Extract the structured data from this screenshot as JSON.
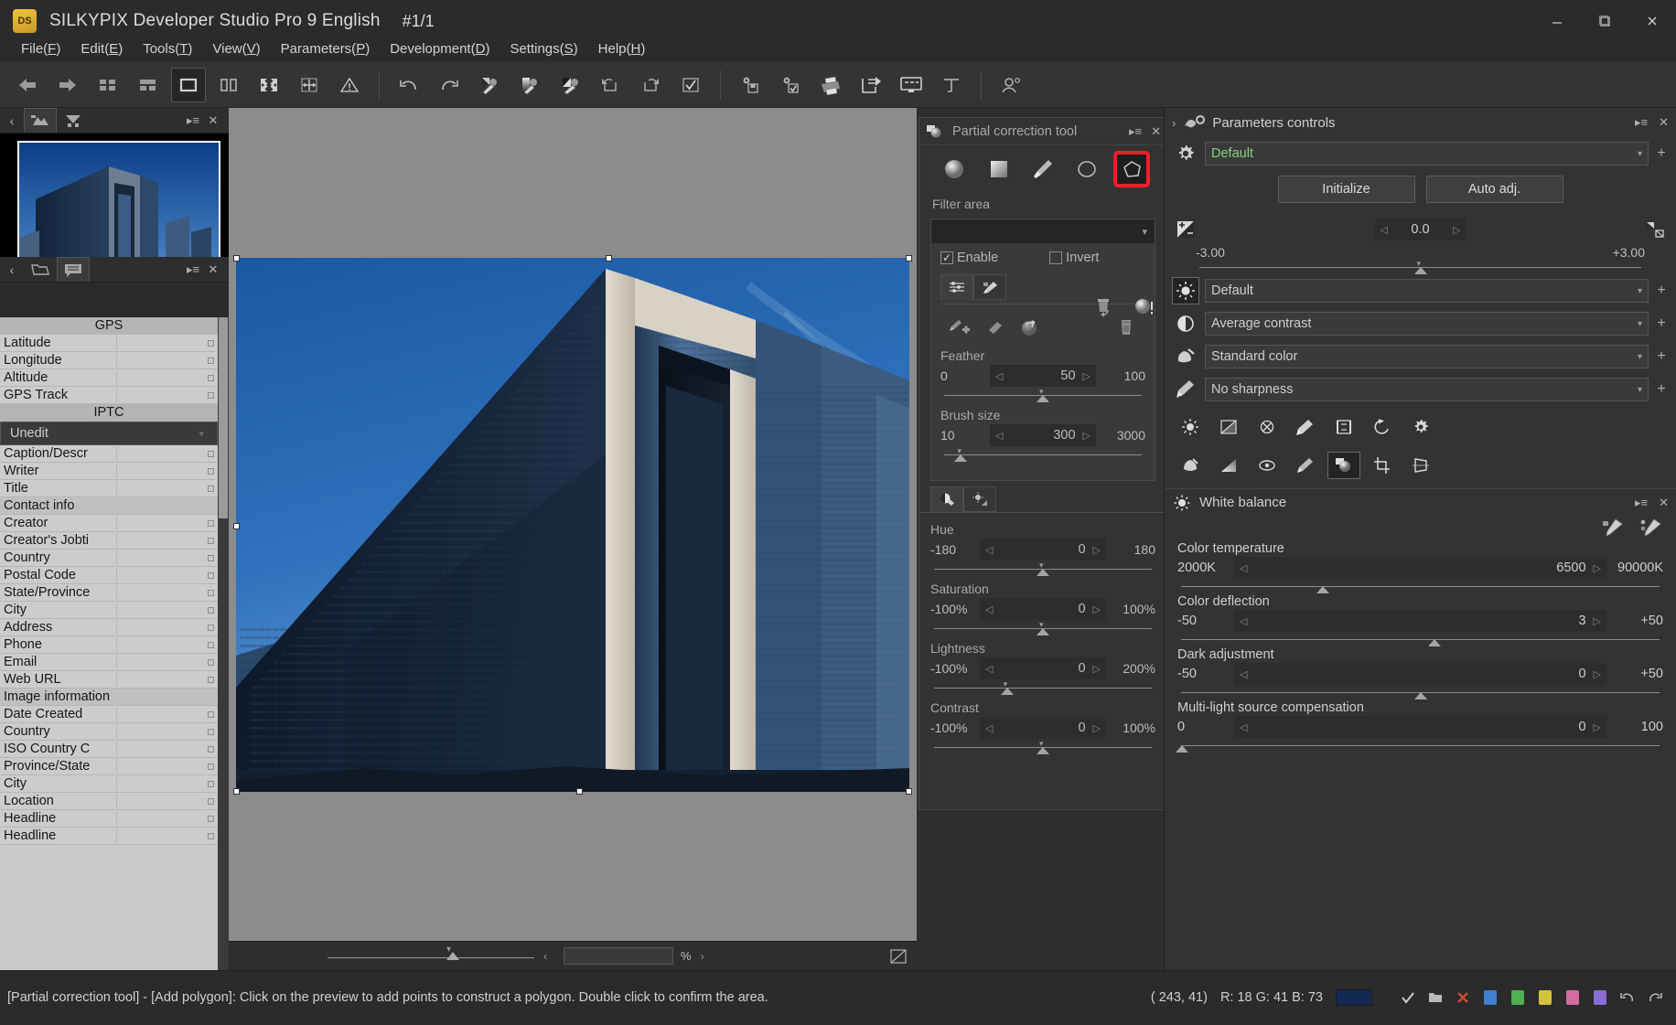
{
  "window": {
    "app_icon": "DS",
    "title": "SILKYPIX Developer Studio Pro 9 English",
    "counter": "#1/1",
    "minimize": "─",
    "maximize": "☐",
    "close": "✕"
  },
  "menubar": [
    {
      "label": "File",
      "accel": "F"
    },
    {
      "label": "Edit",
      "accel": "E"
    },
    {
      "label": "Tools",
      "accel": "T"
    },
    {
      "label": "View",
      "accel": "V"
    },
    {
      "label": "Parameters",
      "accel": "P"
    },
    {
      "label": "Development",
      "accel": "D"
    },
    {
      "label": "Settings",
      "accel": "S"
    },
    {
      "label": "Help",
      "accel": "H"
    }
  ],
  "toolbar": {
    "items": [
      {
        "name": "previous-image-icon",
        "tip": "Previous image"
      },
      {
        "name": "next-image-icon",
        "tip": "Next image"
      },
      {
        "name": "thumbnail-grid-icon",
        "tip": "Thumbnail view"
      },
      {
        "name": "thumbnail-list-icon",
        "tip": "Combination view"
      },
      {
        "name": "single-preview-icon",
        "tip": "Preview only",
        "active": true
      },
      {
        "name": "dual-preview-icon",
        "tip": "Two screen view"
      },
      {
        "name": "fullscreen-icon",
        "tip": "Full screen"
      },
      {
        "name": "fit-screen-icon",
        "tip": "Fit to screen"
      },
      {
        "name": "warning-icon",
        "tip": "Highlight warning"
      },
      {
        "name": "undo-icon",
        "tip": "Undo"
      },
      {
        "name": "redo-icon",
        "tip": "Redo"
      },
      {
        "name": "white-balance-picker-icon",
        "tip": "Grey balance tool"
      },
      {
        "name": "exposure-picker-icon",
        "tip": "Exposure tool"
      },
      {
        "name": "black-point-picker-icon",
        "tip": "Black point tool"
      },
      {
        "name": "rotate-left-icon",
        "tip": "Rotate left"
      },
      {
        "name": "rotate-right-icon",
        "tip": "Rotate right"
      },
      {
        "name": "mark-checkbox-icon",
        "tip": "Mark image"
      },
      {
        "name": "save-settings-icon",
        "tip": "Save development parameters"
      },
      {
        "name": "apply-settings-icon",
        "tip": "Apply parameters"
      },
      {
        "name": "print-icon",
        "tip": "Print"
      },
      {
        "name": "export-icon",
        "tip": "Export"
      },
      {
        "name": "slideshow-icon",
        "tip": "Slideshow"
      },
      {
        "name": "perspective-icon",
        "tip": "Perspective"
      },
      {
        "name": "account-icon",
        "tip": "Account"
      }
    ]
  },
  "left_panel": {
    "top_bar": {
      "collapse": "‹",
      "tabs": [
        {
          "name": "thumbnail-tab",
          "icon": "image-icon",
          "selected": true
        },
        {
          "name": "compare-tab",
          "icon": "compare-icon",
          "selected": false
        }
      ],
      "menu_icon": "▸≡",
      "close_icon": "✕"
    },
    "second_bar": {
      "collapse": "‹",
      "tabs": [
        {
          "name": "folder-tab",
          "icon": "folder-icon",
          "selected": false
        },
        {
          "name": "metadata-tab",
          "icon": "comment-icon",
          "selected": true
        }
      ],
      "menu_icon": "▸≡",
      "close_icon": "✕"
    },
    "metadata_rows": [
      {
        "type": "section",
        "label": "GPS"
      },
      {
        "type": "field",
        "label": "Latitude",
        "value": ""
      },
      {
        "type": "field",
        "label": "Longitude",
        "value": ""
      },
      {
        "type": "field",
        "label": "Altitude",
        "value": ""
      },
      {
        "type": "field",
        "label": "GPS Track",
        "value": ""
      },
      {
        "type": "section",
        "label": "IPTC"
      },
      {
        "type": "combo",
        "label": "Unedit"
      },
      {
        "type": "field",
        "label": "Caption/Descr",
        "value": ""
      },
      {
        "type": "field",
        "label": "Writer",
        "value": ""
      },
      {
        "type": "field",
        "label": "Title",
        "value": ""
      },
      {
        "type": "sub",
        "label": "Contact info"
      },
      {
        "type": "field",
        "label": "Creator",
        "value": ""
      },
      {
        "type": "field",
        "label": "Creator's Jobti",
        "value": ""
      },
      {
        "type": "field",
        "label": "Country",
        "value": ""
      },
      {
        "type": "field",
        "label": "Postal Code",
        "value": ""
      },
      {
        "type": "field",
        "label": "State/Province",
        "value": ""
      },
      {
        "type": "field",
        "label": "City",
        "value": ""
      },
      {
        "type": "field",
        "label": "Address",
        "value": ""
      },
      {
        "type": "field",
        "label": "Phone",
        "value": ""
      },
      {
        "type": "field",
        "label": "Email",
        "value": ""
      },
      {
        "type": "field",
        "label": "Web URL",
        "value": ""
      },
      {
        "type": "sub",
        "label": "Image information"
      },
      {
        "type": "field",
        "label": "Date Created",
        "value": ""
      },
      {
        "type": "field",
        "label": "Country",
        "value": ""
      },
      {
        "type": "field",
        "label": "ISO Country C",
        "value": ""
      },
      {
        "type": "field",
        "label": "Province/State",
        "value": ""
      },
      {
        "type": "field",
        "label": "City",
        "value": ""
      },
      {
        "type": "field",
        "label": "Location",
        "value": ""
      },
      {
        "type": "field",
        "label": "Headline",
        "value": ""
      },
      {
        "type": "field",
        "label": "Headline",
        "value": ""
      }
    ]
  },
  "center": {
    "zoom_percent_label": "%",
    "zoom_value": "",
    "left_arrow": "‹",
    "right_arrow": "›",
    "fit_icon": "fit-icon"
  },
  "partial_correction": {
    "title": "Partial correction tool",
    "title_icon": "partial-correction-icon",
    "menu_icon": "▸≡",
    "close_icon": "✕",
    "tools": [
      {
        "name": "circular-gradient-tool",
        "selected": false
      },
      {
        "name": "linear-gradient-tool",
        "selected": false
      },
      {
        "name": "brush-tool",
        "selected": false
      },
      {
        "name": "ellipse-tool",
        "selected": false
      },
      {
        "name": "polygon-tool",
        "selected": true
      }
    ],
    "reset_icon": "reset-area-icon",
    "preview-mask-icon": "show-mask-icon",
    "filter_area_label": "Filter area",
    "enable_label": "Enable",
    "enable_checked": true,
    "invert_label": "Invert",
    "invert_checked": false,
    "mode_tabs": [
      {
        "name": "settings-mode-tab",
        "selected": true
      },
      {
        "name": "paint-mode-tab",
        "selected": false
      }
    ],
    "brush_actions": [
      {
        "name": "add-brush-icon"
      },
      {
        "name": "eraser-icon"
      },
      {
        "name": "fill-icon"
      },
      {
        "name": "delete-icon"
      }
    ],
    "sliders": [
      {
        "name": "Feather",
        "min": "0",
        "max": "100",
        "value": "50",
        "pos": 50
      },
      {
        "name": "Brush size",
        "min": "10",
        "max": "3000",
        "value": "300",
        "pos": 10
      }
    ],
    "hsl_tabs": [
      {
        "name": "hsl-tab",
        "selected": true
      },
      {
        "name": "exposure-tab",
        "selected": false
      }
    ],
    "hsl_sliders": [
      {
        "name": "Hue",
        "min": "-180",
        "max": "180",
        "value": "0",
        "pos": 50
      },
      {
        "name": "Saturation",
        "min": "-100%",
        "max": "100%",
        "value": "0",
        "pos": 50
      },
      {
        "name": "Lightness",
        "min": "-100%",
        "max": "200%",
        "value": "0",
        "pos": 34
      },
      {
        "name": "Contrast",
        "min": "-100%",
        "max": "100%",
        "value": "0",
        "pos": 50
      }
    ]
  },
  "parameters_controls": {
    "title": "Parameters controls",
    "title_icon": "parameters-controls-icon",
    "chevron": "›",
    "menu_icon": "▸≡",
    "close_icon": "✕",
    "taste_row": {
      "icon": "gear-icon",
      "value": "Default",
      "plus": "+"
    },
    "buttons": {
      "initialize": "Initialize",
      "auto_adjust": "Auto adj."
    },
    "exposure": {
      "icon": "exposure-icon",
      "value": "0.0",
      "min": "-3.00",
      "max": "+3.00",
      "pos": 50,
      "right_icon": "exposure-aux-icon"
    },
    "rows": [
      {
        "icon": "brightness-icon",
        "value": "Default",
        "selected": true
      },
      {
        "icon": "contrast-icon",
        "value": "Average contrast",
        "selected": false
      },
      {
        "icon": "color-icon",
        "value": "Standard color",
        "selected": false
      },
      {
        "icon": "sharpness-icon",
        "value": "No sharpness",
        "selected": false
      }
    ],
    "tool_icons_row1": [
      {
        "name": "noise-reduction-icon"
      },
      {
        "name": "tone-curve-icon"
      },
      {
        "name": "lens-aberration-icon"
      },
      {
        "name": "dodge-burn-icon"
      },
      {
        "name": "hdr-icon"
      },
      {
        "name": "rotation-icon"
      },
      {
        "name": "settings-gear-icon"
      }
    ],
    "tool_icons_row2": [
      {
        "name": "dust-removal-icon"
      },
      {
        "name": "gradient-filter-icon"
      },
      {
        "name": "fisheye-icon"
      },
      {
        "name": "brush-correction-icon"
      },
      {
        "name": "partial-correction-icon",
        "selected": true
      },
      {
        "name": "crop-icon"
      },
      {
        "name": "perspective-correction-icon"
      }
    ]
  },
  "white_balance": {
    "title": "White balance",
    "title_icon": "white-balance-icon",
    "menu_icon": "▸≡",
    "close_icon": "✕",
    "pickers": [
      {
        "name": "grey-picker-icon"
      },
      {
        "name": "skin-picker-icon"
      }
    ],
    "sliders": [
      {
        "name": "Color temperature",
        "min": "2000K",
        "max": "90000K",
        "value": "6500",
        "pos": 30
      },
      {
        "name": "Color deflection",
        "min": "-50",
        "max": "+50",
        "value": "3",
        "pos": 53
      },
      {
        "name": "Dark adjustment",
        "min": "-50",
        "max": "+50",
        "value": "0",
        "pos": 50
      },
      {
        "name": "Multi-light source compensation",
        "min": "0",
        "max": "100",
        "value": "0",
        "pos": 1
      }
    ]
  },
  "statusbar": {
    "message": "[Partial correction tool] - [Add polygon]: Click on the preview to add points to construct a polygon. Double click to confirm the area.",
    "coords": "( 243,   41)",
    "rgb": "R: 18 G: 41 B: 73",
    "swatch_color": "#122951",
    "icons": [
      {
        "name": "check-icon",
        "color": "#cfcfcf"
      },
      {
        "name": "folder-small-icon",
        "color": "#b9b9b9"
      },
      {
        "name": "delete-red-icon",
        "color": "#d04a3a"
      },
      {
        "name": "rating-blue-icon",
        "color": "#3f7fd0"
      },
      {
        "name": "rating-green-icon",
        "color": "#4fb04f"
      },
      {
        "name": "rating-yellow-icon",
        "color": "#d4c33c"
      },
      {
        "name": "rating-pink-icon",
        "color": "#d46ca0"
      },
      {
        "name": "rating-purple-icon",
        "color": "#8a6cd4"
      },
      {
        "name": "undo-small-icon",
        "color": "#b9b9b9"
      },
      {
        "name": "redo-small-icon",
        "color": "#b9b9b9"
      }
    ]
  }
}
